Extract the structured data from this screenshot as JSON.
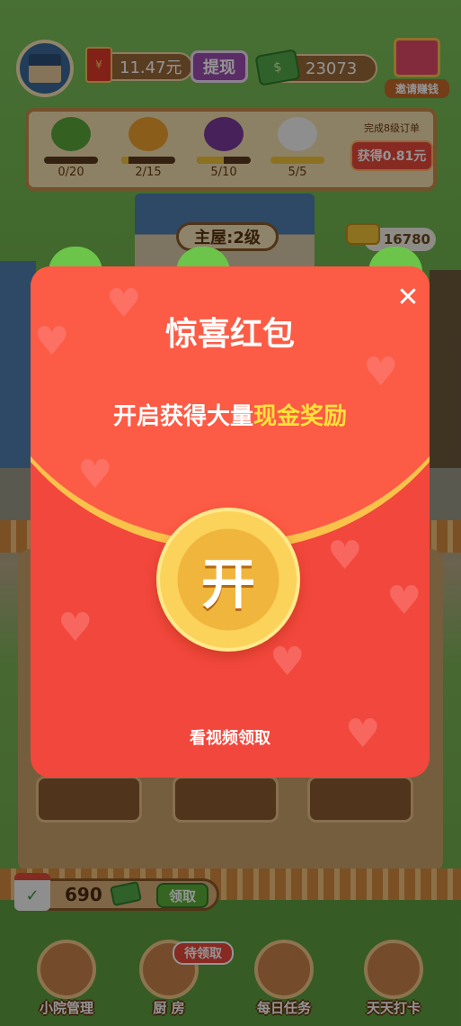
{
  "top_bar": {
    "cash_balance": "11.47元",
    "withdraw_label": "提现",
    "coin_balance": "23073",
    "invite_label": "邀请赚钱",
    "redpacket_symbol": "¥"
  },
  "orders": {
    "items": [
      {
        "name": "edamame",
        "count": "0/20",
        "progress": 0.0,
        "color": "#5aa83a"
      },
      {
        "name": "pumpkin",
        "count": "2/15",
        "progress": 0.13,
        "color": "#f0a030"
      },
      {
        "name": "grapes",
        "count": "5/10",
        "progress": 0.5,
        "color": "#7a3a9a"
      },
      {
        "name": "tofu",
        "count": "5/5",
        "progress": 1.0,
        "color": "#f4f4f4"
      }
    ],
    "task_text": "完成8级订单",
    "claim_label": "获得0.81元"
  },
  "house": {
    "label": "主屋:2级",
    "gold_count": "16780"
  },
  "modal": {
    "title": "惊喜红包",
    "subtitle_prefix": "开启获得大量",
    "subtitle_highlight": "现金奖励",
    "open_label": "开",
    "watch_label": "看视频领取",
    "close_symbol": "✕"
  },
  "reward_bar": {
    "amount": "690",
    "claim_label": "领取"
  },
  "bottom_nav": {
    "pending_badge": "待领取",
    "items": [
      {
        "label": "小院管理"
      },
      {
        "label": "厨 房"
      },
      {
        "label": "每日任务"
      },
      {
        "label": "天天打卡"
      }
    ]
  },
  "colors": {
    "modal_red": "#f2473c",
    "highlight_yellow": "#ffe23a",
    "coin_gold": "#f0b53c"
  }
}
